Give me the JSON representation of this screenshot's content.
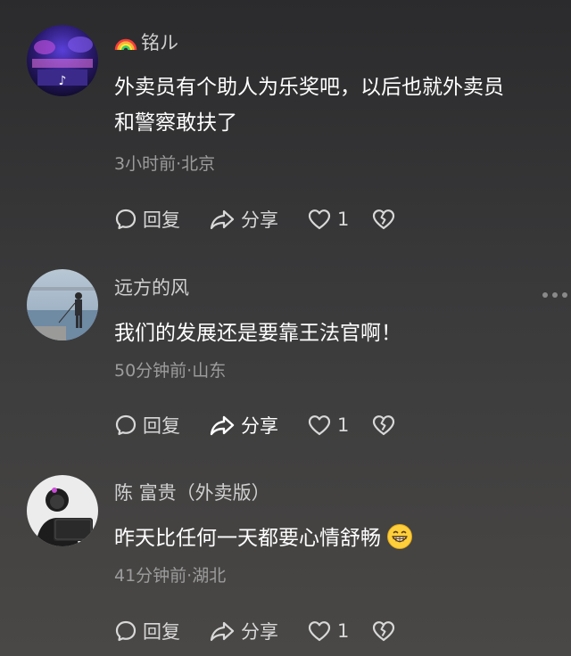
{
  "comments": [
    {
      "username": "铭ル",
      "content_line1": "外卖员有个助人为乐奖吧，以后也就外卖员",
      "content_line2": "和警察敢扶了",
      "meta": "3小时前·北京",
      "reply_label": "回复",
      "share_label": "分享",
      "like_count": "1"
    },
    {
      "username": "远方的风",
      "content": "我们的发展还是要靠王法官啊！",
      "meta": "50分钟前·山东",
      "reply_label": "回复",
      "share_label": "分享",
      "like_count": "1"
    },
    {
      "username": "陈 富贵（外卖版）",
      "content": "昨天比任何一天都要心情舒畅",
      "emoji": "grinning-face-emoji",
      "meta": "41分钟前·湖北",
      "reply_label": "回复",
      "share_label": "分享",
      "like_count": "1"
    }
  ],
  "icons": {
    "reply": "chat-bubble-icon",
    "share": "share-arrow-icon",
    "like": "heart-icon",
    "dislike": "broken-heart-icon",
    "more": "more-dots-icon",
    "rainbow": "rainbow-emoji"
  },
  "colors": {
    "username": "#cfcfcf",
    "meta": "#9c9c9c",
    "action": "#d8d8d8"
  }
}
